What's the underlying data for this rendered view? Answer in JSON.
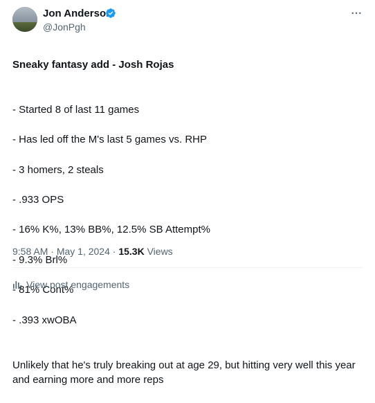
{
  "author": {
    "name": "Jon Anderson",
    "handle": "@JonPgh",
    "verified_icon": "verified-badge-icon",
    "verified_color": "#1d9bf0"
  },
  "tweet": {
    "headline": "Sneaky fantasy add - Josh Rojas",
    "bullets": [
      "- Started 8 of last 11 games",
      "- Has led off the M's last 5 games vs. RHP",
      "- 3 homers, 2 steals",
      "- .933 OPS",
      "- 16% K%, 13% BB%, 12.5% SB Attempt%",
      "- 9.3% Brl%",
      "- 81% Cont%",
      "- .393 xwOBA"
    ],
    "closing": "Unlikely that he's truly breaking out at age 29, but hitting very well this year and earning more and more reps"
  },
  "meta": {
    "time": "9:58 AM",
    "separator1": " · ",
    "date": "May 1, 2024",
    "separator2": " · ",
    "views_count": "15.3K",
    "views_label": " Views"
  },
  "engagements": {
    "label": "View post engagements",
    "icon": "analytics-icon"
  },
  "more_icon": "more-options-icon",
  "colors": {
    "text": "#0f1419",
    "secondary": "#536471",
    "divider": "#eff3f4"
  }
}
